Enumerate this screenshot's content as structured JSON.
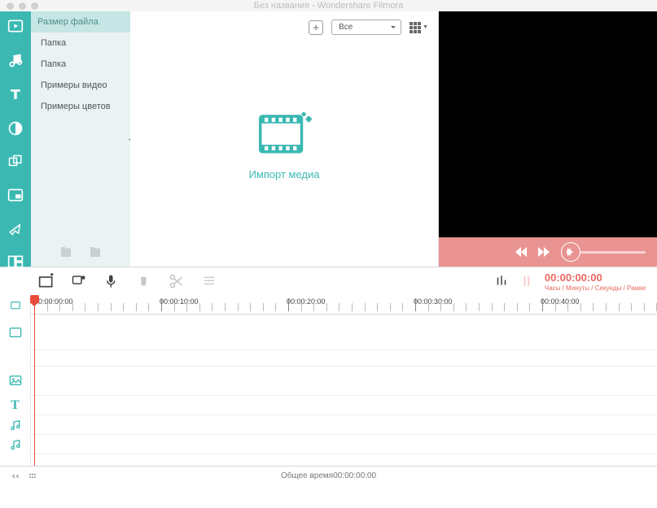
{
  "titlebar": {
    "title": "Без названия - Wondershare Filmora"
  },
  "sidebar_tools": [
    "media",
    "music",
    "text",
    "color",
    "transitions",
    "pip",
    "zoom",
    "split"
  ],
  "panel": {
    "header": "Размер файла",
    "items": [
      "Папка",
      "Папка",
      "Примеры видео",
      "Примеры цветов"
    ]
  },
  "media": {
    "filter_select": "Все",
    "import_label": "Импорт медиа"
  },
  "timeline": {
    "timecode": "00:00:00:00",
    "timecode_sub": "Часы / Минуты / Секунды / Рамки",
    "ruler": [
      "00:00:00:00",
      "00:00:10:00",
      "00:00:20:00",
      "00:00:30:00",
      "00:00:40:00"
    ]
  },
  "statusbar": {
    "total_label": "Общее время",
    "total_value": "00:00:00:00"
  }
}
